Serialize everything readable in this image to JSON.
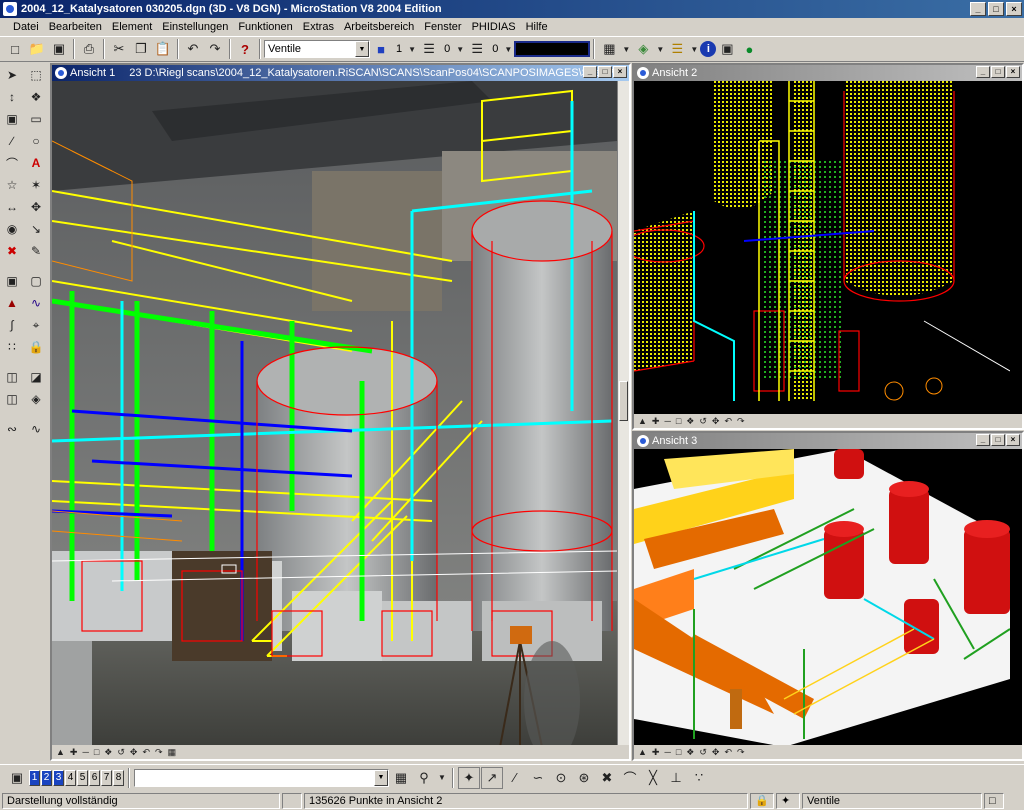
{
  "window": {
    "title": "2004_12_Katalysatoren 030205.dgn (3D - V8 DGN) - MicroStation V8 2004 Edition",
    "minimize": "_",
    "maximize": "□",
    "close": "×"
  },
  "menu": [
    "Datei",
    "Bearbeiten",
    "Element",
    "Einstellungen",
    "Funktionen",
    "Extras",
    "Arbeitsbereich",
    "Fenster",
    "PHIDIAS",
    "Hilfe"
  ],
  "toolbar": {
    "level_value": "Ventile",
    "color_value": "1",
    "linestyle_value": "0",
    "weight_value": "0",
    "help_glyph": "?"
  },
  "views": {
    "v1": {
      "title": "Ansicht 1",
      "path": "23 D:\\Riegl scans\\2004_12_Katalysatoren.RiSCAN\\SCANS\\ScanPos04\\SCANPOSIMAGES\\ScanP"
    },
    "v2": {
      "title": "Ansicht 2"
    },
    "v3": {
      "title": "Ansicht 3"
    }
  },
  "bottom_bar": {
    "view_numbers": [
      "1",
      "2",
      "3",
      "4",
      "5",
      "6",
      "7",
      "8"
    ],
    "active_views": [
      "1",
      "2",
      "3"
    ]
  },
  "status": {
    "left": "Darstellung vollständig",
    "middle": "135626 Punkte in Ansicht 2",
    "level": "Ventile"
  },
  "colors": {
    "title_active": "#0a246a",
    "pipe_yellow": "#ffff00",
    "pipe_green": "#00ff00",
    "pipe_cyan": "#00ffff",
    "pipe_red": "#ff0000",
    "pipe_blue": "#0000ff",
    "pipe_orange": "#ff8c00"
  }
}
